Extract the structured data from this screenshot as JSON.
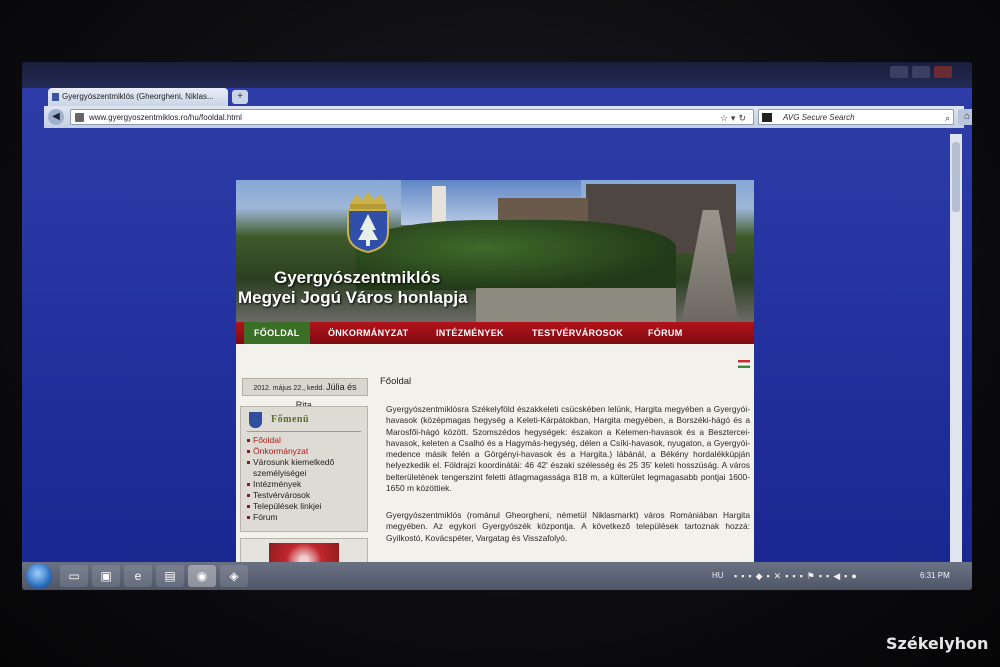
{
  "browser": {
    "tab_title": "Gyergyószentmiklós (Gheorgheni, Niklas...",
    "new_tab": "+",
    "url": "www.gyergyoszentmiklos.ro/hu/fooldal.html",
    "search_placeholder": "AVG Secure Search"
  },
  "site": {
    "title_line1": "Gyergyószentmiklós",
    "title_line2": "Megyei Jogú Város honlapja",
    "menu": [
      {
        "label": "FŐOLDAL"
      },
      {
        "label": "ÖNKORMÁNYZAT"
      },
      {
        "label": "INTÉZMÉNYEK"
      },
      {
        "label": "TESTVÉRVÁROSOK"
      },
      {
        "label": "FÓRUM"
      }
    ],
    "date_text": "2012. május 22., kedd.",
    "date_names": "Júlia és Rita.",
    "sidebar_heading": "Főmenü",
    "sidebar_items": [
      {
        "label": "Főoldal"
      },
      {
        "label": "Önkormányzat"
      },
      {
        "label": "Városunk kiemelkedő személyiségei"
      },
      {
        "label": "Intézmények"
      },
      {
        "label": "Testvérvárosok"
      },
      {
        "label": "Települések linkjei"
      },
      {
        "label": "Fórum"
      }
    ],
    "page_title": "Főoldal",
    "paragraph1": "Gyergyószentmiklósra Székelyföld északkeleti csücskében lelünk, Hargita megyében a Gyergyói-havasok (középmagas hegység a Keleti-Kárpátokban, Hargita megyében, a Borszéki-hágó és a Marosfői-hágó között. Szomszédos hegységek: északon a Kelemen-havasok és a Besztercei-havasok, keleten a Csalhó és a Hagymás-hegység, délen a Csíki-havasok, nyugaton, a Gyergyói-medence másik felén a Görgényi-havasok és a Hargita.) lábánál, a Békény hordalékkúpján helyezkedik el. Földrajzi koordinátái: 46 42' északi szélesség és 25 35' keleti hosszúság. A város belterületének tengerszint feletti átlagmagassága 818 m, a külterület legmagasabb pontjai 1600-1650 m közöttiek.",
    "paragraph2": "Gyergyószentmiklós (románul Gheorgheni, németül Niklasmarkt) város Romániában Hargita megyében. Az egykori Gyergyószék központja. A következő települések tartoznak hozzá: Gyilkostó, Kovácspéter, Vargatag és Visszafolyó."
  },
  "taskbar": {
    "lang": "HU",
    "clock": "6:31 PM"
  },
  "watermark": "Székelyhon"
}
